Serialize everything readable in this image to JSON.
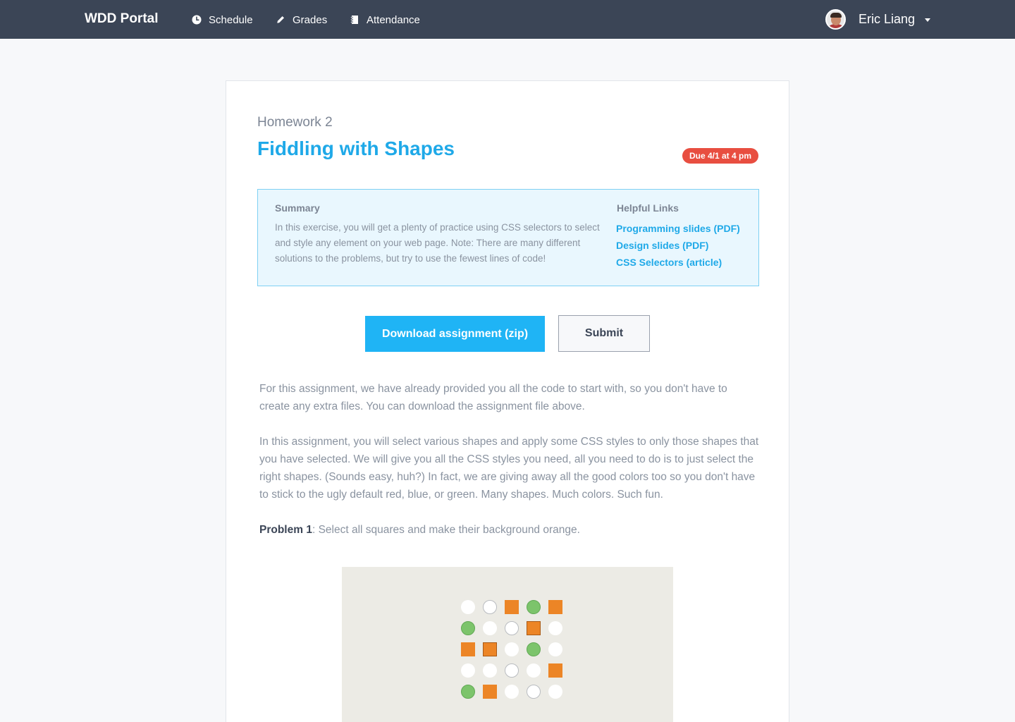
{
  "nav": {
    "brand": "WDD Portal",
    "links": [
      {
        "label": "Schedule",
        "icon": "clock-icon"
      },
      {
        "label": "Grades",
        "icon": "pencil-icon"
      },
      {
        "label": "Attendance",
        "icon": "notebook-icon"
      }
    ],
    "user": {
      "name": "Eric Liang"
    }
  },
  "assignment": {
    "label": "Homework 2",
    "title": "Fiddling with Shapes",
    "due": "Due 4/1 at 4 pm",
    "summary": {
      "heading": "Summary",
      "text": "In this exercise, you will get a plenty of practice using CSS selectors to select and style any element on your web page. Note: There are many different solutions to the problems, but try to use the fewest lines of code!"
    },
    "helpful_links": {
      "heading": "Helpful Links",
      "items": [
        "Programming slides (PDF)",
        "Design slides (PDF)",
        "CSS Selectors (article)"
      ]
    },
    "buttons": {
      "download": "Download assignment (zip)",
      "submit": "Submit"
    },
    "paragraphs": [
      "For this assignment, we have already provided you all the code to start with, so you don't have to create any extra files. You can download the assignment file above.",
      "In this assignment, you will select various shapes and apply some CSS styles to only those shapes that you have selected. We will give you all the CSS styles you need, all you need to do is to just select the right shapes. (Sounds easy, huh?) In fact, we are giving away all the good colors too so you don't have to stick to the ugly default red, blue, or green. Many shapes. Much colors. Such fun."
    ],
    "problem": {
      "label": "Problem 1",
      "text": ": Select all squares and make their background orange."
    },
    "shapes": [
      [
        "white-circle",
        "outlined-circle",
        "orange-square",
        "green-circle",
        "orange-square"
      ],
      [
        "green-circle",
        "white-circle",
        "outlined-circle",
        "orange-outlined-square",
        "white-circle"
      ],
      [
        "orange-square",
        "orange-outlined-square",
        "white-circle",
        "green-circle",
        "white-circle"
      ],
      [
        "white-circle",
        "white-circle",
        "outlined-circle",
        "white-circle",
        "orange-square"
      ],
      [
        "green-circle",
        "orange-square",
        "white-circle",
        "outlined-circle",
        "white-circle"
      ]
    ]
  },
  "colors": {
    "nav_bg": "#3b4556",
    "accent": "#1fa9e8",
    "button": "#1fb4f5",
    "due_badge": "#e84e40",
    "summary_bg": "#e9f7fe",
    "orange": "#ec8526",
    "green": "#7cc46b",
    "stage_bg": "#ecebe5"
  }
}
